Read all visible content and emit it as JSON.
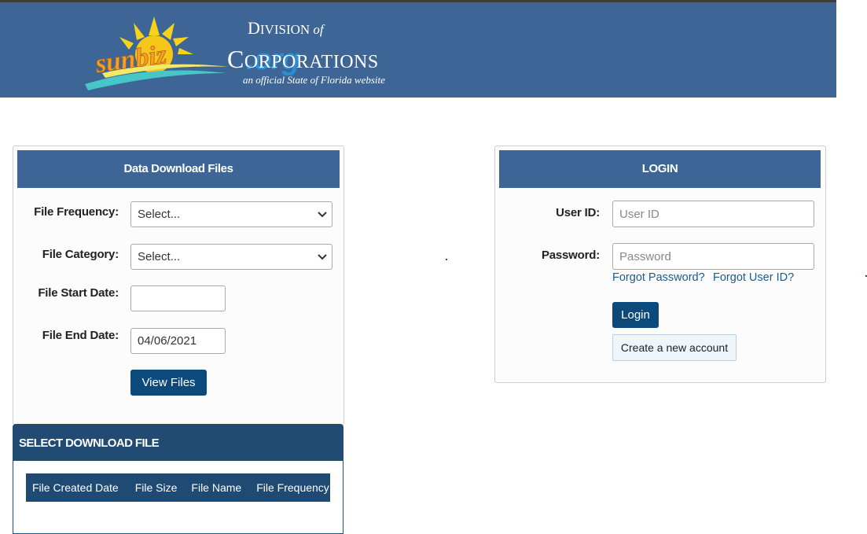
{
  "header": {
    "logo_text": "sunbiz",
    "logo_org": ".org",
    "division_prefix": "D",
    "division_rest": "IVISION",
    "division_of": "of",
    "corp_prefix": "C",
    "corp_rest": "ORPORATIONS",
    "tagline": "an official State of Florida website"
  },
  "download_panel": {
    "title": "Data Download Files",
    "frequency_label": "File Frequency:",
    "frequency_value": "Select...",
    "category_label": "File Category:",
    "category_value": "Select...",
    "start_label": "File Start Date:",
    "start_value": "",
    "end_label": "File End Date:",
    "end_value": "04/06/2021",
    "view_button": "View Files"
  },
  "select_download": {
    "title": "SELECT DOWNLOAD FILE",
    "columns": [
      "File Created Date",
      "File Size",
      "File Name",
      "File Frequency"
    ]
  },
  "login_panel": {
    "title": "LOGIN",
    "userid_label": "User ID:",
    "userid_placeholder": "User ID",
    "password_label": "Password:",
    "password_placeholder": "Password",
    "forgot_password": "Forgot Password?",
    "forgot_userid": "Forgot User ID?",
    "login_button": "Login",
    "create_account": "Create a new account"
  },
  "colors": {
    "header_bg": "#3d6696",
    "panel_title_bg": "#3d6696",
    "button_bg": "#0b4a7a",
    "section_head_bg": "#224b74",
    "link": "#1d5b8c"
  }
}
